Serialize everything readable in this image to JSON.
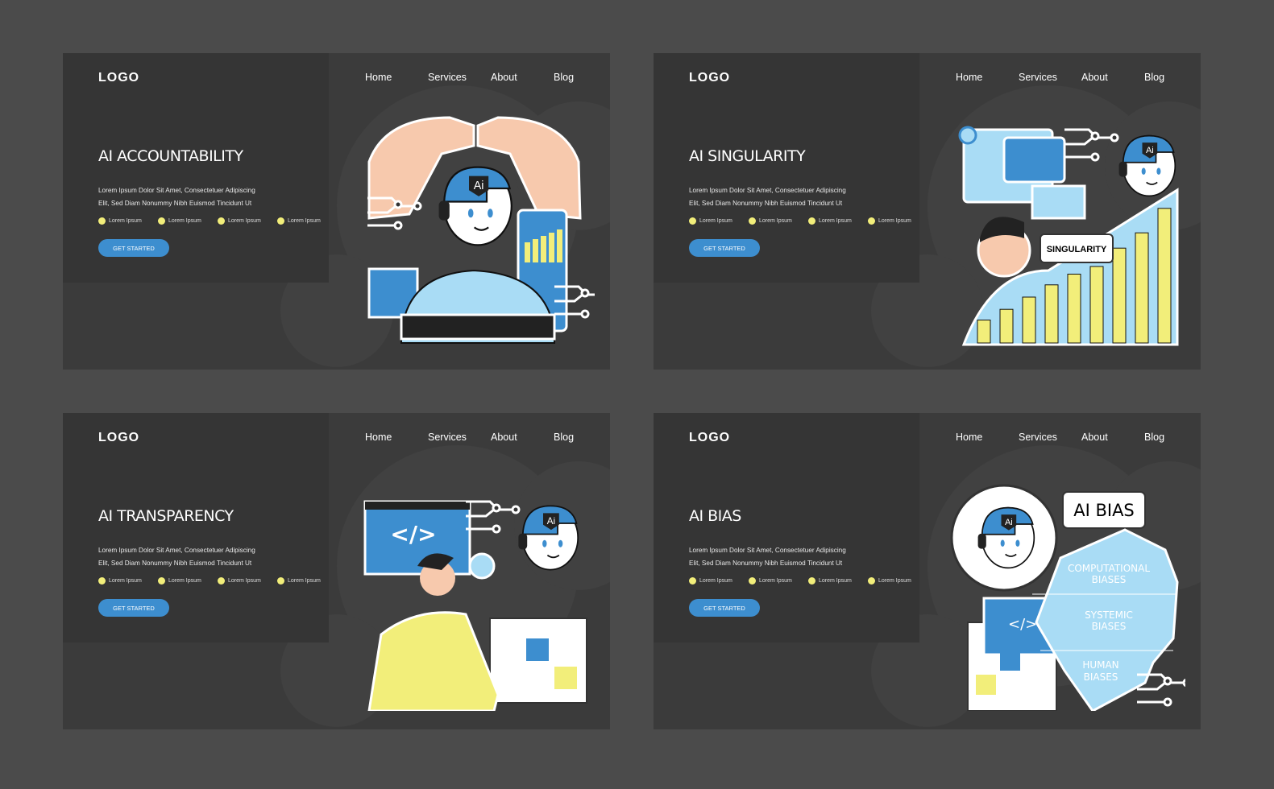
{
  "nav": {
    "logo": "LOGO",
    "items": [
      "Home",
      "Services",
      "About",
      "Blog"
    ]
  },
  "description": [
    "Lorem Ipsum Dolor Sit Amet, Consectetuer Adipiscing",
    "Elit, Sed Diam Nonummy Nibh Euismod Tincidunt Ut"
  ],
  "bullets": [
    "Lorem Ipsum",
    "Lorem Ipsum",
    "Lorem Ipsum",
    "Lorem Ipsum"
  ],
  "button_label": "GET STARTED",
  "panels": [
    {
      "title": "AI ACCOUNTABILITY",
      "illustration": {
        "badge": "Ai"
      }
    },
    {
      "title": "AI SINGULARITY",
      "illustration": {
        "badge": "Ai",
        "bubble": "SINGULARITY",
        "growth_bars": [
          0.15,
          0.22,
          0.3,
          0.38,
          0.45,
          0.5,
          0.62,
          0.72,
          0.88
        ]
      }
    },
    {
      "title": "AI TRANSPARENCY",
      "illustration": {
        "badge": "Ai",
        "code": "</>"
      }
    },
    {
      "title": "AI BIAS",
      "illustration": {
        "badge": "Ai",
        "bubble": "AI BIAS",
        "code": "</>",
        "layers": [
          "COMPUTATIONAL",
          "BIASES",
          "SYSTEMIC",
          "BIASES",
          "HUMAN",
          "BIASES"
        ]
      }
    }
  ],
  "colors": {
    "background": "#4b4b4b",
    "panel": "#3b3b3b",
    "accent": "#3d8ecf",
    "bullet": "#f2ee7a",
    "light_blue": "#a9dcf5"
  }
}
